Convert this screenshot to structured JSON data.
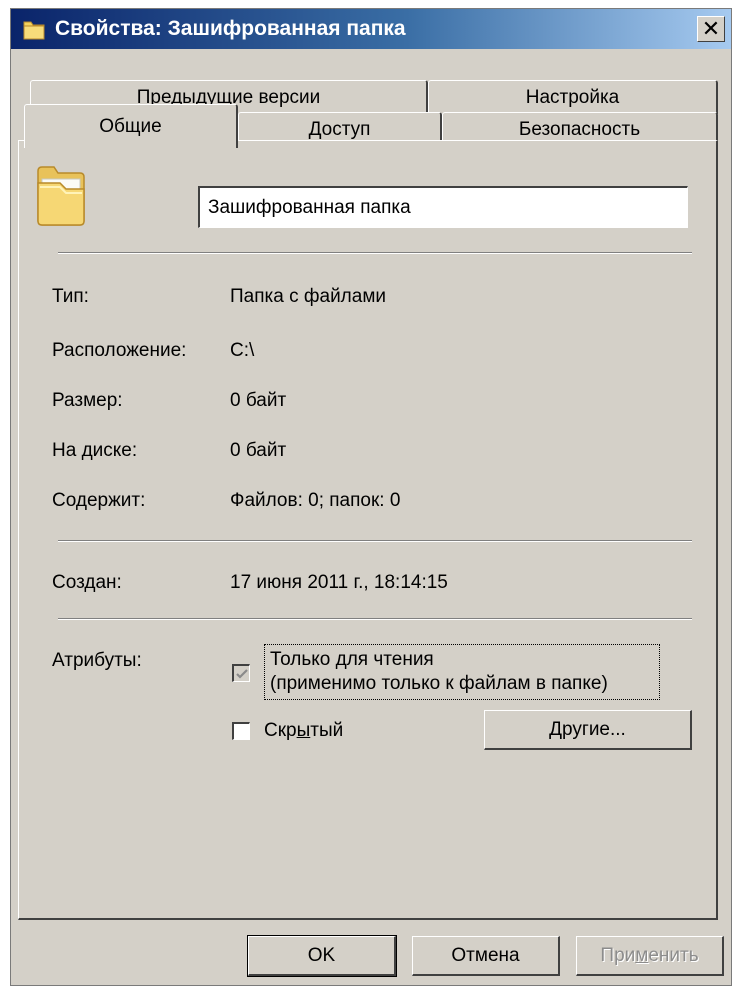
{
  "window": {
    "title": "Свойства: Зашифрованная папка",
    "close_label": "✕"
  },
  "tabs": {
    "prev_versions": "Предыдущие версии",
    "settings": "Настройка",
    "general": "Общие",
    "access": "Доступ",
    "security": "Безопасность"
  },
  "general": {
    "name_value": "Зашифрованная папка",
    "type_label": "Тип:",
    "type_value": "Папка с файлами",
    "location_label": "Расположение:",
    "location_value": "C:\\",
    "size_label": "Размер:",
    "size_value": "0 байт",
    "ondisk_label": "На диске:",
    "ondisk_value": "0 байт",
    "contains_label": "Содержит:",
    "contains_value": "Файлов: 0; папок: 0",
    "created_label": "Создан:",
    "created_value": "17 июня 2011 г., 18:14:15",
    "attributes_label": "Атрибуты:",
    "readonly_line1": "Только для чтения",
    "readonly_line2": "(применимо только к файлам в папке)",
    "readonly_checked": true,
    "hidden_pre": "Скр",
    "hidden_u": "ы",
    "hidden_post": "тый",
    "hidden_checked": false,
    "other_u": "Д",
    "other_post": "ругие..."
  },
  "buttons": {
    "ok": "OK",
    "cancel": "Отмена",
    "apply_pre": "При",
    "apply_u": "м",
    "apply_post": "енить"
  },
  "colors": {
    "dialog_bg": "#d4d0c8",
    "title_start": "#0a246a",
    "title_end": "#a6caf0"
  },
  "icons": {
    "title": "folder-icon",
    "close": "close-icon",
    "main": "folder-icon",
    "check": "checkmark-icon"
  }
}
